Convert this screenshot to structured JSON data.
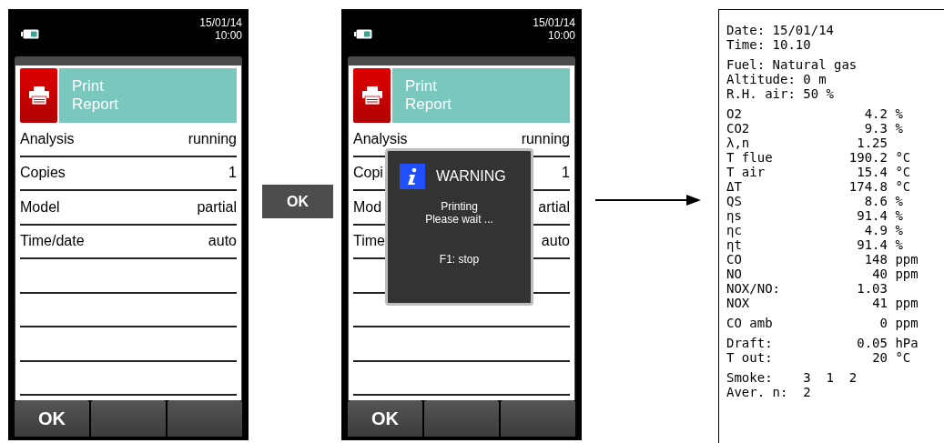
{
  "screens": [
    {
      "status": {
        "date": "15/01/14",
        "time": "10:00"
      },
      "header": {
        "title": "Print Report"
      },
      "rows": [
        {
          "label": "Analysis",
          "value": "running"
        },
        {
          "label": "Copies",
          "value": "1"
        },
        {
          "label": "Model",
          "value": "partial"
        },
        {
          "label": "Time/date",
          "value": "auto"
        }
      ],
      "softkeys": [
        "OK"
      ]
    },
    {
      "status": {
        "date": "15/01/14",
        "time": "10:00"
      },
      "header": {
        "title": "Print Report"
      },
      "rows": [
        {
          "label": "Analysis",
          "value": "running"
        },
        {
          "label": "Copi",
          "value": "1"
        },
        {
          "label": "Mod",
          "value": "artial"
        },
        {
          "label": "Time",
          "value": "auto"
        }
      ],
      "softkeys": [
        "OK"
      ],
      "popup": {
        "title": "WARNING",
        "message": "Printing\nPlease wait ...",
        "hint": "F1: stop"
      }
    }
  ],
  "key": {
    "label": "OK"
  },
  "receipt": {
    "sections": [
      {
        "lines": [
          {
            "kind": "text",
            "text": "Date: 15/01/14"
          },
          {
            "kind": "text",
            "text": "Time: 10.10"
          }
        ]
      },
      {
        "lines": [
          {
            "kind": "text",
            "text": "Fuel: Natural gas"
          },
          {
            "kind": "text",
            "text": "Altitude: 0 m"
          },
          {
            "kind": "text",
            "text": "R.H. air: 50 %"
          }
        ]
      },
      {
        "lines": [
          {
            "kind": "reading",
            "label": "O2",
            "value": "4.2",
            "unit": "%"
          },
          {
            "kind": "reading",
            "label": "CO2",
            "value": "9.3",
            "unit": "%"
          },
          {
            "kind": "reading",
            "label": "λ,n",
            "value": "1.25"
          },
          {
            "kind": "reading",
            "label": "T flue",
            "value": "190.2",
            "unit": "°C"
          },
          {
            "kind": "reading",
            "label": "T air",
            "value": "15.4",
            "unit": "°C"
          },
          {
            "kind": "reading",
            "label": "ΔT",
            "value": "174.8",
            "unit": "°C"
          },
          {
            "kind": "reading",
            "label": "QS",
            "value": "8.6",
            "unit": "%"
          },
          {
            "kind": "reading",
            "label": "ηs",
            "value": "91.4",
            "unit": "%"
          },
          {
            "kind": "reading",
            "label": "ηc",
            "value": "4.9",
            "unit": "%"
          },
          {
            "kind": "reading",
            "label": "ηt",
            "value": "91.4",
            "unit": "%"
          },
          {
            "kind": "reading",
            "label": "CO",
            "value": "148",
            "unit": "ppm"
          },
          {
            "kind": "reading",
            "label": "NO",
            "value": "40",
            "unit": "ppm"
          },
          {
            "kind": "reading",
            "label": "NOX/NO:",
            "value": "1.03"
          },
          {
            "kind": "reading",
            "label": "NOX",
            "value": "41",
            "unit": "ppm"
          }
        ]
      },
      {
        "lines": [
          {
            "kind": "reading",
            "label": "CO amb",
            "value": "0",
            "unit": "ppm"
          }
        ]
      },
      {
        "lines": [
          {
            "kind": "reading",
            "label": "Draft:",
            "value": "0.05",
            "unit": "hPa"
          },
          {
            "kind": "reading",
            "label": "T out:",
            "value": "20",
            "unit": "°C"
          }
        ]
      },
      {
        "lines": [
          {
            "kind": "text",
            "text": "Smoke:    3  1  2"
          },
          {
            "kind": "text",
            "text": "Aver. n:  2"
          }
        ]
      }
    ]
  }
}
